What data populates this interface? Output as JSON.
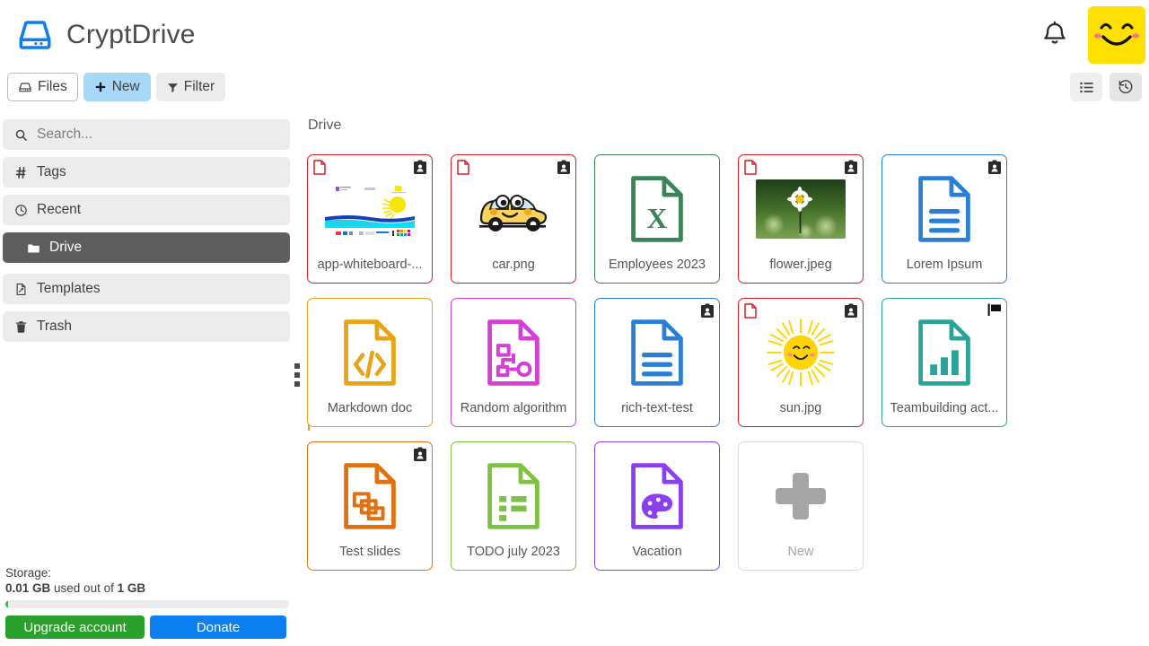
{
  "app": {
    "title": "CryptDrive",
    "logo_icon": "hard-drive-icon",
    "brand_color": "#0b7ff0"
  },
  "header": {
    "bell_icon": "notification-bell-icon",
    "avatar_icon": "smiley-avatar-icon",
    "avatar_color": "#FFE000"
  },
  "toolbar": {
    "files_label": "Files",
    "files_icon": "drive-icon",
    "new_label": "New",
    "new_icon": "plus-icon",
    "new_color": "#A8D8F8",
    "filter_label": "Filter",
    "filter_icon": "funnel-icon",
    "list_view_icon": "list-view-icon",
    "history_icon": "history-icon"
  },
  "sidebar": {
    "items": [
      {
        "label": "Search...",
        "icon": "search-icon",
        "name": "search",
        "active": false
      },
      {
        "label": "Tags",
        "icon": "hash-icon",
        "name": "tags",
        "active": false
      },
      {
        "label": "Recent",
        "icon": "clock-icon",
        "name": "recent",
        "active": false
      },
      {
        "label": "Drive",
        "icon": "folder-icon",
        "name": "drive",
        "active": true
      },
      {
        "label": "Templates",
        "icon": "template-icon",
        "name": "templates",
        "active": false
      },
      {
        "label": "Trash",
        "icon": "trash-icon",
        "name": "trash",
        "active": false
      }
    ],
    "storage": {
      "label": "Storage:",
      "used": "0.01 GB",
      "used_suffix": " used out of ",
      "total": "1 GB",
      "percent": 1,
      "bar_color": "#46b450",
      "upgrade_label": "Upgrade account",
      "upgrade_color": "#2aa12a",
      "donate_label": "Donate",
      "donate_color": "#0b7ff0"
    }
  },
  "main": {
    "breadcrumb": "Drive",
    "rows": [
      [
        {
          "name": "app-whiteboard-...",
          "border": "#e01b24",
          "icon": "whiteboard-thumbnail",
          "badge": "contact-badge-icon",
          "corner": "file-corner-icon",
          "color": "#e01b24"
        },
        {
          "name": "car.png",
          "border": "#e01b24",
          "icon": "car-thumbnail",
          "badge": "contact-badge-icon",
          "corner": "file-corner-icon",
          "color": "#e01b24"
        },
        {
          "name": "Employees 2023",
          "border": "#3a8457",
          "icon": "spreadsheet-icon",
          "badge": "",
          "corner": "",
          "color": "#3a8457"
        },
        {
          "name": "flower.jpeg",
          "border": "#e01b24",
          "icon": "flower-thumbnail",
          "badge": "contact-badge-icon",
          "corner": "file-corner-icon",
          "color": "#e01b24"
        },
        {
          "name": "Lorem Ipsum",
          "border": "#2a7fd4",
          "icon": "text-document-icon",
          "badge": "contact-badge-icon",
          "corner": "",
          "color": "#2a7fd4"
        }
      ],
      [
        {
          "name": "Markdown doc",
          "border": "#e8a317",
          "icon": "code-document-icon",
          "badge": "",
          "corner": "",
          "color": "#e8a317"
        },
        {
          "name": "Random algorithm",
          "border": "#d43fd4",
          "icon": "diagram-document-icon",
          "badge": "",
          "corner": "",
          "color": "#d43fd4"
        },
        {
          "name": "rich-text-test",
          "border": "#2a7fd4",
          "icon": "text-document-icon",
          "badge": "contact-badge-icon",
          "corner": "",
          "color": "#2a7fd4"
        },
        {
          "name": "sun.jpg",
          "border": "#e01b24",
          "icon": "sun-thumbnail",
          "badge": "contact-badge-icon",
          "corner": "file-corner-icon",
          "color": "#e01b24"
        },
        {
          "name": "Teambuilding act...",
          "border": "#2aa398",
          "icon": "chart-document-icon",
          "badge": "flag-badge-icon",
          "corner": "",
          "color": "#2aa398"
        }
      ],
      [
        {
          "name": "Test slides",
          "border": "#e2700f",
          "icon": "slides-document-icon",
          "badge": "contact-badge-icon",
          "corner": "",
          "color": "#e2700f"
        },
        {
          "name": "TODO july 2023",
          "border": "#7dc243",
          "icon": "todo-document-icon",
          "badge": "",
          "corner": "",
          "color": "#7dc243"
        },
        {
          "name": "Vacation",
          "border": "#8a3ff0",
          "icon": "palette-document-icon",
          "badge": "",
          "corner": "",
          "color": "#8a3ff0"
        },
        {
          "name": "New",
          "border": "#dcdcdc",
          "icon": "plus-large-icon",
          "badge": "",
          "corner": "",
          "color": "#a5a5a5",
          "is_new": true
        }
      ]
    ]
  }
}
